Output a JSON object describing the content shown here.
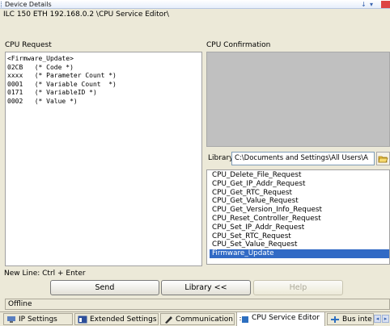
{
  "window": {
    "title": "Device Details",
    "pin_glyph": "↓",
    "menu_glyph": "▾"
  },
  "path": "ILC 150 ETH 192.168.0.2 \\CPU Service Editor\\",
  "request": {
    "label": "CPU Request",
    "lines": [
      "<Firmware_Update>",
      "02CB   (* Code *)",
      "xxxx   (* Parameter Count *)",
      "0001   (* Variable Count  *)",
      "0171   (* VariableID *)",
      "0002   (* Value *)"
    ]
  },
  "confirmation": {
    "label": "CPU Confirmation"
  },
  "library": {
    "label": "Library:",
    "path_value": "C:\\Documents and Settings\\All Users\\A",
    "items": [
      "CPU_Delete_File_Request",
      "CPU_Get_IP_Addr_Request",
      "CPU_Get_RTC_Request",
      "CPU_Get_Value_Request",
      "CPU_Get_Version_Info_Request",
      "CPU_Reset_Controller_Request",
      "CPU_Set_IP_Addr_Request",
      "CPU_Set_RTC_Request",
      "CPU_Set_Value_Request",
      "Firmware_Update"
    ],
    "selected_index": 9
  },
  "hint": "New Line: Ctrl + Enter",
  "buttons": {
    "send": "Send",
    "library": "Library <<",
    "help": "Help"
  },
  "status": "Offline",
  "tabs": [
    "IP Settings",
    "Extended Settings",
    "Communication",
    "CPU Service Editor",
    "Bus inte"
  ],
  "active_tab": "CPU Service Editor",
  "scroll": {
    "left": "◂",
    "right": "▸"
  }
}
